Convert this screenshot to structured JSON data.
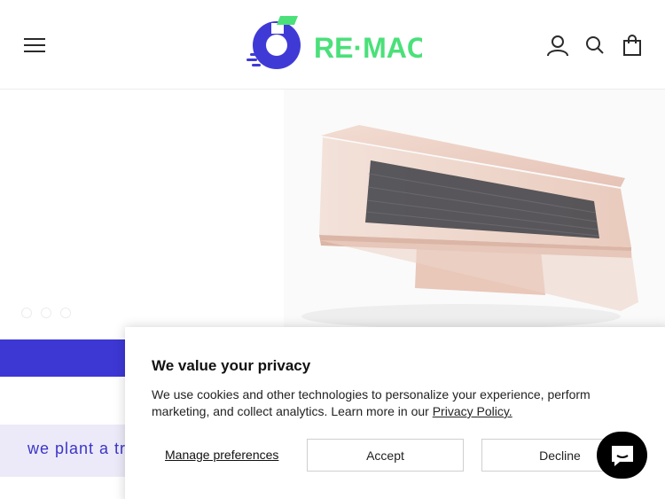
{
  "header": {
    "menu_icon": "hamburger-menu-icon",
    "logo_text": "RE·MACS",
    "account_icon": "account-icon",
    "search_icon": "search-icon",
    "cart_icon": "shopping-bag-icon"
  },
  "hero": {
    "image": "laptop-photo",
    "slides": 3,
    "active_slide": 1
  },
  "banner": {
    "text": "we plant a tre"
  },
  "cookie": {
    "title": "We value your privacy",
    "body_text": "We use cookies and other technologies to personalize your experience, perform marketing, and collect analytics. Learn more in our ",
    "policy_link": "Privacy Policy.",
    "manage_label": "Manage preferences",
    "accept_label": "Accept",
    "decline_label": "Decline"
  },
  "chat": {
    "icon": "chat-icon"
  },
  "colors": {
    "brand_purple": "#3d37d4",
    "logo_green": "#4be07a",
    "lavender": "#eceaf8"
  }
}
